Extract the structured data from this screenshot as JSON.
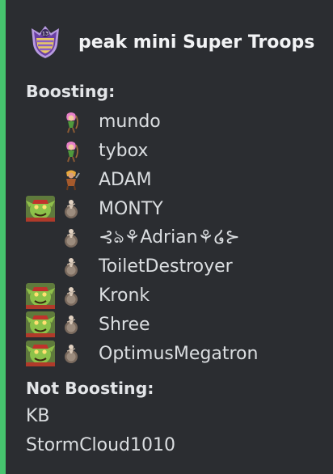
{
  "embed": {
    "accent_color": "#46c46e",
    "background": "#2b2d31",
    "title": "peak mini Super Troops",
    "badge_icon": "clan-badge-icon"
  },
  "boosting": {
    "label": "Boosting:",
    "players": [
      {
        "name": "mundo",
        "hero_icon": null,
        "troop_icon": "archer-icon"
      },
      {
        "name": "tybox",
        "hero_icon": null,
        "troop_icon": "archer-icon"
      },
      {
        "name": "ADAM",
        "hero_icon": null,
        "troop_icon": "barbarian-icon"
      },
      {
        "name": "MONTY",
        "hero_icon": "goblin-icon",
        "troop_icon": "miner-icon"
      },
      {
        "name": "⊰ঌ⚘Adrian⚘໒⊱",
        "hero_icon": null,
        "troop_icon": "miner-icon"
      },
      {
        "name": "ToiletDestroyer",
        "hero_icon": null,
        "troop_icon": "miner-icon"
      },
      {
        "name": "Kronk",
        "hero_icon": "goblin-icon",
        "troop_icon": "miner-icon"
      },
      {
        "name": "Shree",
        "hero_icon": "goblin-icon",
        "troop_icon": "miner-icon"
      },
      {
        "name": "OptimusMegatron",
        "hero_icon": "goblin-icon",
        "troop_icon": "miner-icon"
      }
    ]
  },
  "not_boosting": {
    "label": "Not Boosting:",
    "players": [
      "KB",
      "StormCloud1010"
    ]
  }
}
